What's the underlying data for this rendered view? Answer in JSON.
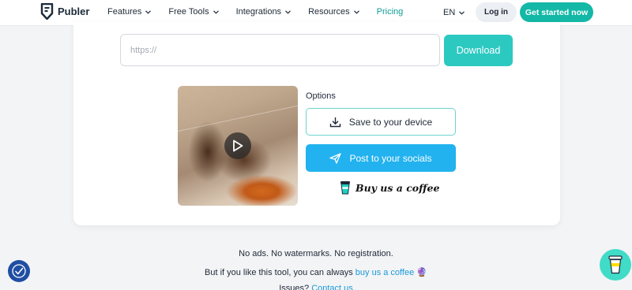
{
  "brand": {
    "name": "Publer",
    "accent": "#14b8a6"
  },
  "nav": {
    "items": [
      {
        "label": "Features",
        "has_dropdown": true
      },
      {
        "label": "Free Tools",
        "has_dropdown": true
      },
      {
        "label": "Integrations",
        "has_dropdown": true
      },
      {
        "label": "Resources",
        "has_dropdown": true
      },
      {
        "label": "Pricing",
        "has_dropdown": false
      }
    ],
    "language": "EN",
    "login_label": "Log in",
    "cta_label": "Get started now"
  },
  "downloader": {
    "url_placeholder": "https://",
    "url_value": "",
    "download_label": "Download"
  },
  "options": {
    "title": "Options",
    "save_label": "Save to your device",
    "post_label": "Post to your socials",
    "coffee_label": "Buy us a coffee"
  },
  "footer": {
    "line1": "No ads. No watermarks. No registration.",
    "line2_prefix": "But if you like this tool, you can always",
    "line2_link": "buy us a coffee",
    "line2_suffix": "🔮",
    "line3_prefix": "Issues?",
    "line3_link": "Contact us"
  },
  "icons": {
    "play": "play-icon",
    "download": "download-icon",
    "send": "send-icon",
    "coffee_cup": "coffee-cup-icon",
    "accessibility": "accessibility-icon"
  }
}
